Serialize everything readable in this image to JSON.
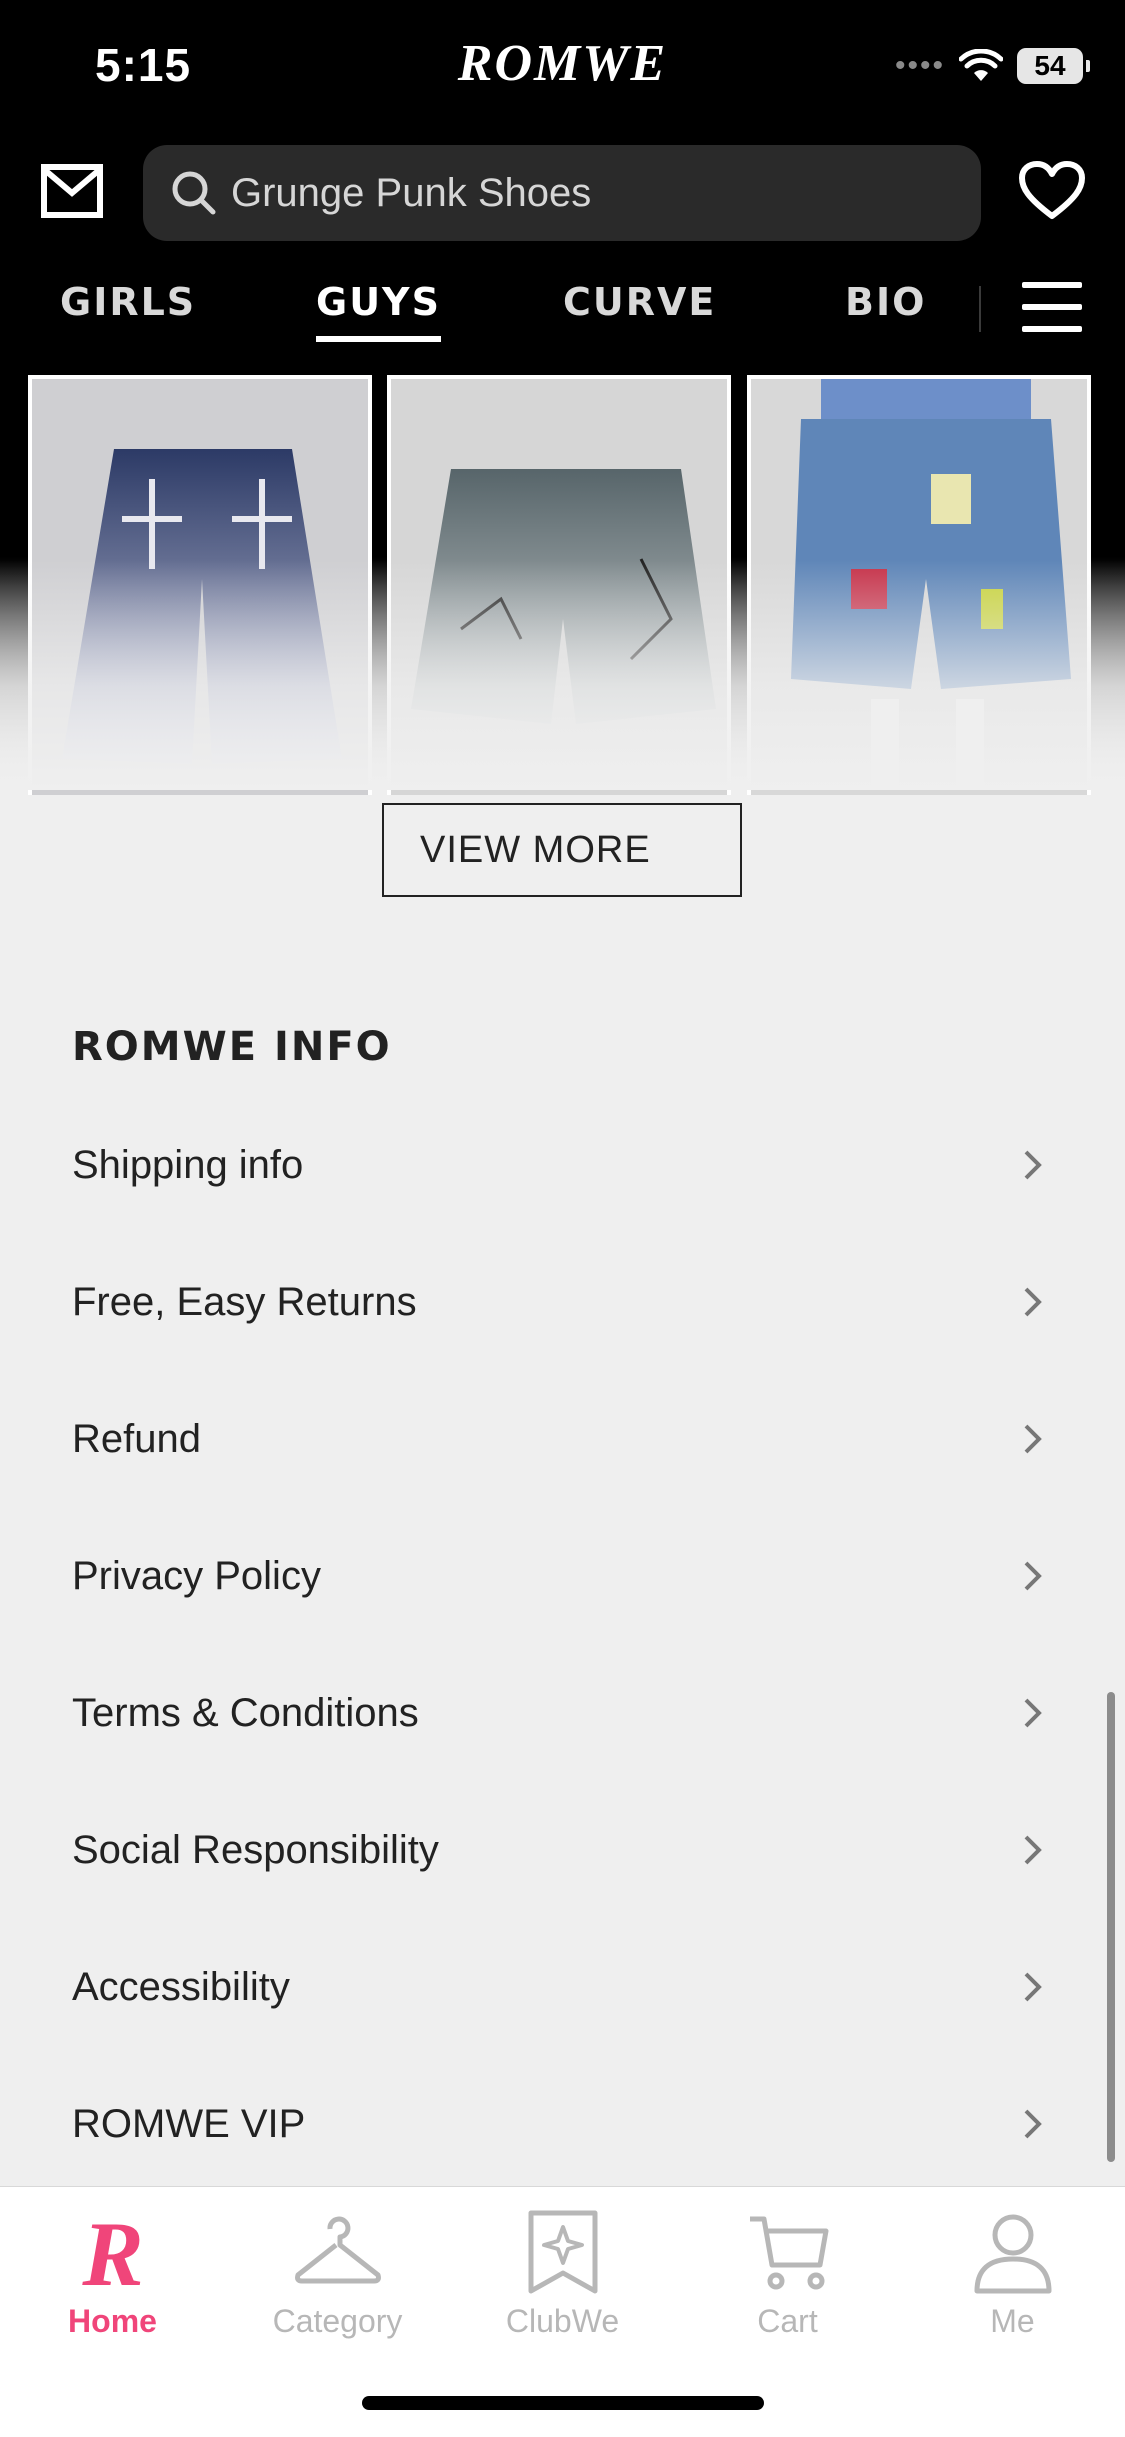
{
  "status_bar": {
    "time": "5:15",
    "brand": "ROMWE",
    "battery": "54"
  },
  "header": {
    "search_text": "Grunge Punk Shoes",
    "icons": [
      "mail-icon",
      "search-icon",
      "heart-icon",
      "menu-icon"
    ]
  },
  "tabs": [
    {
      "label": "GIRLS"
    },
    {
      "label": "GUYS"
    },
    {
      "label": "CURVE"
    },
    {
      "label": "BIO"
    }
  ],
  "active_tab": "GUYS",
  "products": [
    {
      "type": "dark denim shorts with cross embroidery"
    },
    {
      "type": "grey denim shorts with spider-web print"
    },
    {
      "type": "model wearing patched denim shorts"
    }
  ],
  "view_more_label": "VIEW MORE",
  "info": {
    "title": "ROMWE INFO",
    "items": [
      {
        "label": "Shipping info"
      },
      {
        "label": "Free, Easy Returns"
      },
      {
        "label": "Refund"
      },
      {
        "label": "Privacy Policy"
      },
      {
        "label": "Terms & Conditions"
      },
      {
        "label": "Social Responsibility"
      },
      {
        "label": "Accessibility"
      },
      {
        "label": "ROMWE VIP"
      }
    ]
  },
  "bottom_nav": [
    {
      "label": "Home",
      "icon": "romwe-r-icon"
    },
    {
      "label": "Category",
      "icon": "hanger-icon"
    },
    {
      "label": "ClubWe",
      "icon": "clubwe-icon"
    },
    {
      "label": "Cart",
      "icon": "cart-icon"
    },
    {
      "label": "Me",
      "icon": "person-icon"
    }
  ],
  "colors": {
    "accent": "#f0457a",
    "header_bg": "#000000",
    "page_bg": "#efefef",
    "inactive": "#b7b7b7"
  }
}
